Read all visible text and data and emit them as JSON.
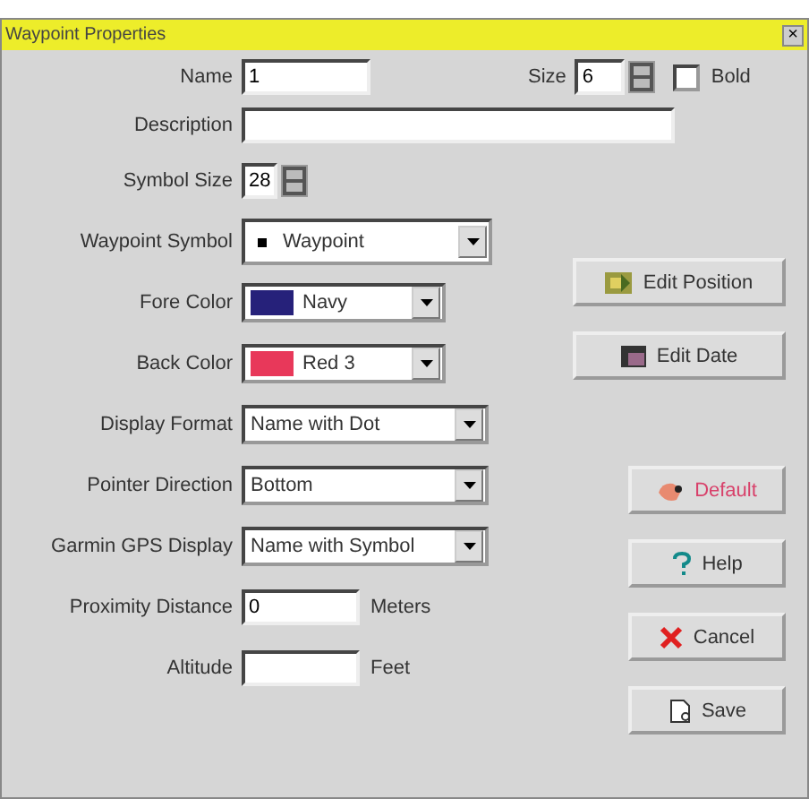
{
  "window": {
    "title": "Waypoint Properties",
    "close": "×"
  },
  "name": {
    "label": "Name",
    "value": "1"
  },
  "size": {
    "label": "Size",
    "value": "6"
  },
  "bold": {
    "label": "Bold",
    "checked": false
  },
  "description": {
    "label": "Description"
  },
  "symbol_size": {
    "label": "Symbol Size",
    "value": "28"
  },
  "rows": [
    {
      "kind": "symbol",
      "label": "Waypoint Symbol",
      "value": "Waypoint"
    },
    {
      "kind": "color",
      "label": "Fore Color",
      "value": "Navy",
      "color": "#26217a"
    },
    {
      "kind": "color",
      "label": "Back Color",
      "value": "Red 3",
      "color": "#e8385a"
    },
    {
      "kind": "select",
      "label": "Display Format",
      "value": "Name with Dot"
    },
    {
      "kind": "select",
      "label": "Pointer Direction",
      "value": "Bottom"
    },
    {
      "kind": "select",
      "label": "Garmin GPS Display",
      "value": "Name with Symbol"
    },
    {
      "kind": "number",
      "label": "Proximity Distance",
      "value": "0",
      "unit": "Meters"
    },
    {
      "kind": "number",
      "label": "Altitude",
      "unit": "Feet"
    }
  ],
  "buttons": [
    {
      "kind": "position",
      "label": "Edit Position"
    },
    {
      "kind": "date",
      "label": "Edit Date"
    },
    {
      "kind": "default",
      "label": "Default"
    },
    {
      "kind": "help",
      "label": "Help"
    },
    {
      "kind": "cancel",
      "label": "Cancel"
    },
    {
      "kind": "save",
      "label": "Save"
    }
  ]
}
